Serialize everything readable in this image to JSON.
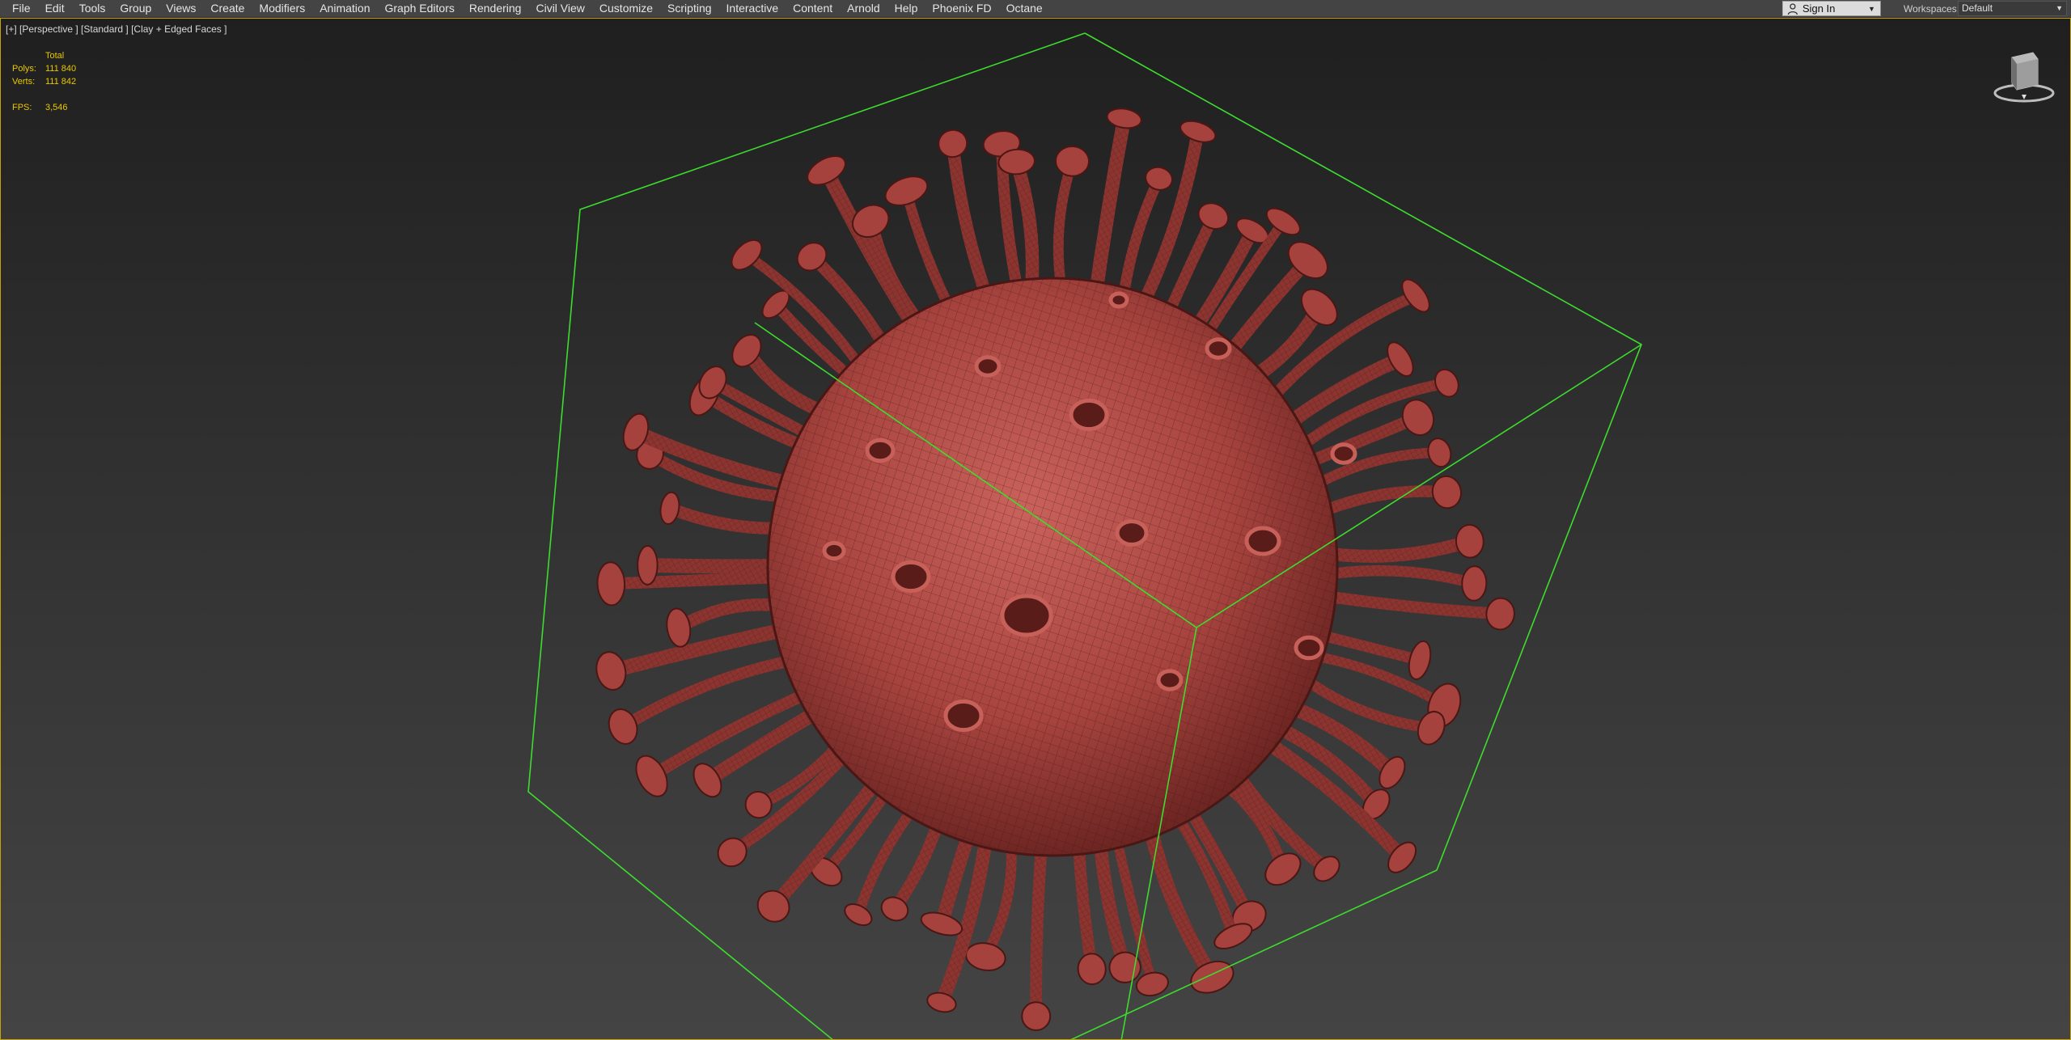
{
  "menu": {
    "items": [
      "File",
      "Edit",
      "Tools",
      "Group",
      "Views",
      "Create",
      "Modifiers",
      "Animation",
      "Graph Editors",
      "Rendering",
      "Civil View",
      "Customize",
      "Scripting",
      "Interactive",
      "Content",
      "Arnold",
      "Help",
      "Phoenix FD",
      "Octane"
    ]
  },
  "account": {
    "signin_label": "Sign In",
    "workspaces_label": "Workspaces:",
    "workspace_value": "Default"
  },
  "viewport": {
    "label": "[+] [Perspective ] [Standard ] [Clay + Edged Faces ]",
    "stats": {
      "total_label": "Total",
      "polys_label": "Polys:",
      "polys_value": "111 840",
      "verts_label": "Verts:",
      "verts_value": "111 842",
      "fps_label": "FPS:",
      "fps_value": "3,546"
    }
  },
  "colors": {
    "bbox": "#3ddc2e",
    "stats": "#e8c800",
    "mesh": "#b04a45",
    "frame": "#c9a300"
  }
}
